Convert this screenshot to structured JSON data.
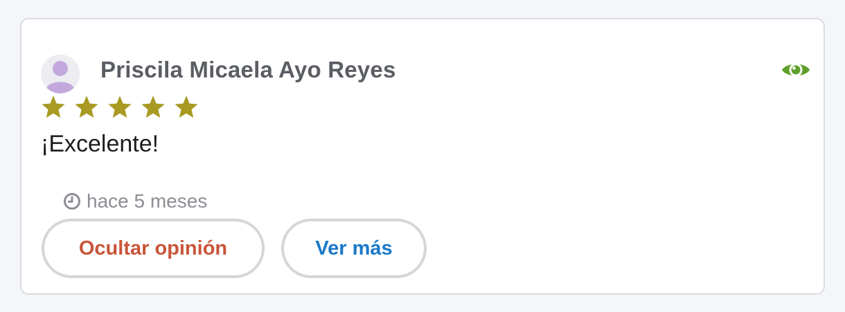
{
  "review": {
    "reviewer_name": "Priscila Micaela Ayo Reyes",
    "rating": 5,
    "max_rating": 5,
    "comment": "¡Excelente!",
    "time_ago": "hace 5 meses"
  },
  "actions": {
    "hide_label": "Ocultar opinión",
    "more_label": "Ver más"
  },
  "icons": {
    "avatar": "user-avatar-icon",
    "visibility": "eye-icon",
    "star": "star-icon",
    "time": "clock-icon"
  },
  "colors": {
    "star": "#a89a22",
    "eye": "#5fa02a",
    "hide_button_text": "#c8553a",
    "more_button_text": "#1a78c8",
    "name_text": "#5a5d63",
    "muted_text": "#8b8e93",
    "avatar_fg": "#c2a8dc"
  }
}
